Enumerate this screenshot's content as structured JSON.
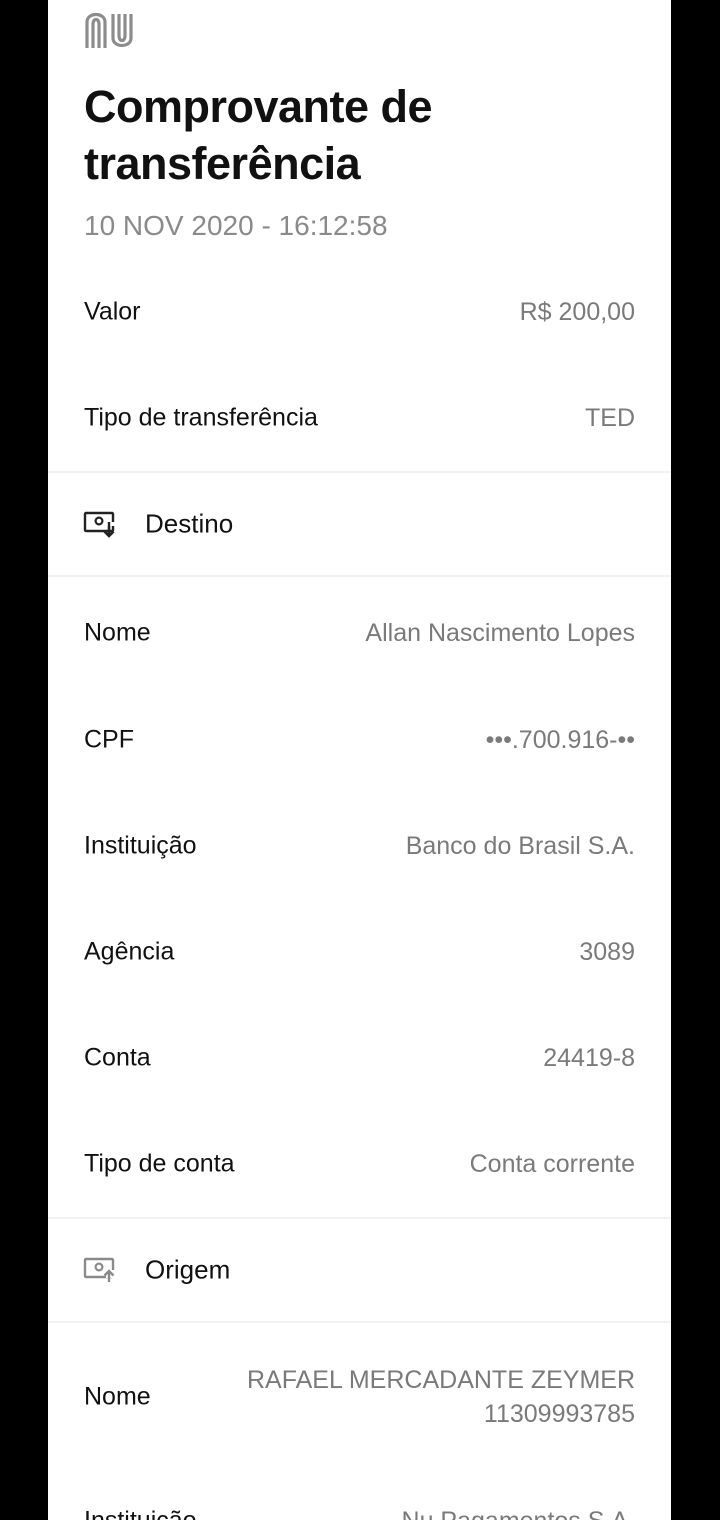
{
  "header": {
    "logo_icon": "nubank-logo",
    "title": "Comprovante de transferência",
    "datetime": "10 NOV 2020 - 16:12:58"
  },
  "summary": [
    {
      "label": "Valor",
      "value": "R$ 200,00"
    },
    {
      "label": "Tipo de transferência",
      "value": "TED"
    }
  ],
  "destino": {
    "section_label": "Destino",
    "icon": "money-receive-icon",
    "rows": [
      {
        "label": "Nome",
        "value": "Allan Nascimento Lopes"
      },
      {
        "label": "CPF",
        "value": "•••.700.916-••"
      },
      {
        "label": "Instituição",
        "value": "Banco do Brasil S.A."
      },
      {
        "label": "Agência",
        "value": "3089"
      },
      {
        "label": "Conta",
        "value": "24419-8"
      },
      {
        "label": "Tipo de conta",
        "value": "Conta corrente"
      }
    ]
  },
  "origem": {
    "section_label": "Origem",
    "icon": "money-send-icon",
    "rows": [
      {
        "label": "Nome",
        "value_line1": "RAFAEL MERCADANTE ZEYMER",
        "value_line2": "11309993785"
      },
      {
        "label": "Instituição",
        "value": "Nu Pagamentos S.A."
      }
    ]
  }
}
